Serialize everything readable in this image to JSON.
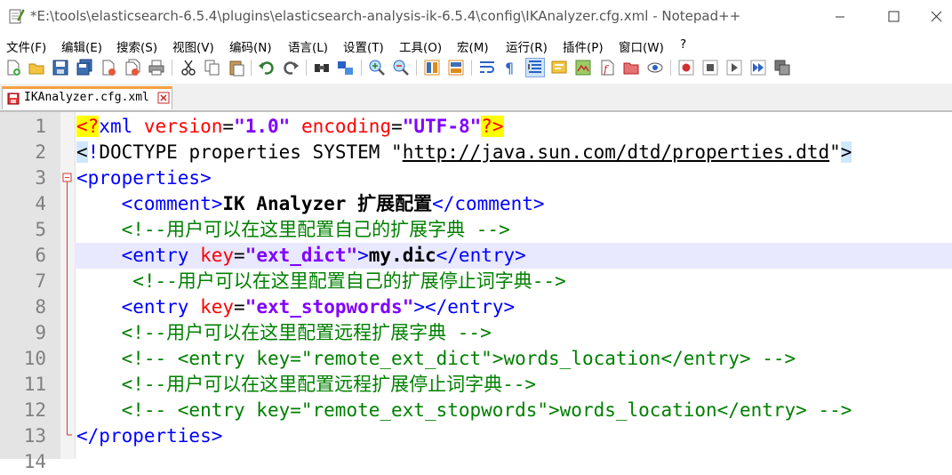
{
  "window": {
    "title": "*E:\\tools\\elasticsearch-6.5.4\\plugins\\elasticsearch-analysis-ik-6.5.4\\config\\IKAnalyzer.cfg.xml - Notepad++"
  },
  "menu": [
    "文件(F)",
    "编辑(E)",
    "搜索(S)",
    "视图(V)",
    "编码(N)",
    "语言(L)",
    "设置(T)",
    "工具(O)",
    "宏(M)",
    "运行(R)",
    "插件(P)",
    "窗口(W)",
    "?"
  ],
  "tab": {
    "label": "IKAnalyzer.cfg.xml"
  },
  "editor": {
    "current_line": 6,
    "line_numbers": [
      "1",
      "2",
      "3",
      "4",
      "5",
      "6",
      "7",
      "8",
      "9",
      "10",
      "11",
      "12",
      "13",
      "14"
    ],
    "code": {
      "l1": {
        "pi_open": "<?",
        "name": "xml",
        "a1": "version",
        "eq": "=",
        "v1": "\"1.0\"",
        "a2": "encoding",
        "v2": "\"UTF-8\"",
        "pi_close": "?>"
      },
      "l2": {
        "open": "<",
        "bang": "!",
        "body": "DOCTYPE properties SYSTEM \"",
        "url": "http://java.sun.com/dtd/properties.dtd",
        "quote": "\"",
        "close": ">"
      },
      "l3": {
        "tag": "<properties>"
      },
      "l4": {
        "open": "<comment>",
        "text": "IK Analyzer 扩展配置",
        "close": "</comment>"
      },
      "l5": {
        "comment": "<!--用户可以在这里配置自己的扩展字典 -->"
      },
      "l6": {
        "open": "<entry ",
        "attr": "key",
        "eq": "=",
        "val": "\"ext_dict\"",
        "gt": ">",
        "text": "my.dic",
        "close": "</entry>"
      },
      "l7": {
        "comment": "<!--用户可以在这里配置自己的扩展停止词字典-->"
      },
      "l8": {
        "open": "<entry ",
        "attr": "key",
        "eq": "=",
        "val": "\"ext_stopwords\"",
        "close": "></entry>"
      },
      "l9": {
        "comment": "<!--用户可以在这里配置远程扩展字典 -->"
      },
      "l10": {
        "comment": "<!-- <entry key=\"remote_ext_dict\">words_location</entry> -->"
      },
      "l11": {
        "comment": "<!--用户可以在这里配置远程扩展停止词字典-->"
      },
      "l12": {
        "comment": "<!-- <entry key=\"remote_ext_stopwords\">words_location</entry> -->"
      },
      "l13": {
        "tag": "</properties>"
      }
    }
  },
  "icons": {
    "app": "notepad-icon",
    "minimize": "minimize-icon",
    "maximize": "maximize-icon",
    "close": "close-icon",
    "tab_save_state": "unsaved-file-icon",
    "tab_close": "tab-close-icon"
  },
  "colors": {
    "tag": "#0000ff",
    "attribute": "#ff0000",
    "string": "#8000ff",
    "comment": "#008000",
    "current_line": "#e8e8ff",
    "tab_accent": "#f5a040"
  }
}
